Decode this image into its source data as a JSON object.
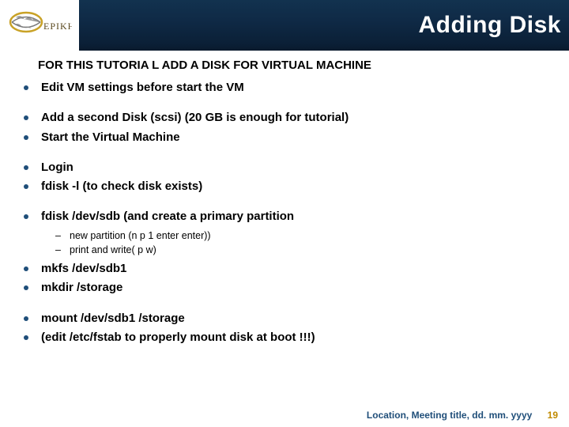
{
  "header": {
    "title": "Adding Disk",
    "logo_text": "EPIKH"
  },
  "subtitle": "FOR THIS TUTORIA L ADD A  DISK FOR VIRTUAL MACHINE",
  "bullets": {
    "b0": "Edit VM settings before start the VM",
    "b1": "Add a second Disk (scsi)  (20 GB is enough for tutorial)",
    "b2": "Start the Virtual Machine",
    "b3": "Login",
    "b4": "fdisk -l  (to check disk exists)",
    "b5": "fdisk /dev/sdb (and create a primary partition",
    "b5_sub0": " new partition (n p 1 enter enter))",
    "b5_sub1": "print and write( p w)",
    "b6": "mkfs /dev/sdb1",
    "b7": "mkdir /storage",
    "b8": "mount /dev/sdb1 /storage",
    "b9": "(edit /etc/fstab to properly mount disk at boot !!!)"
  },
  "footer": {
    "meta": "Location, Meeting title, dd. mm. yyyy",
    "page": "19"
  }
}
